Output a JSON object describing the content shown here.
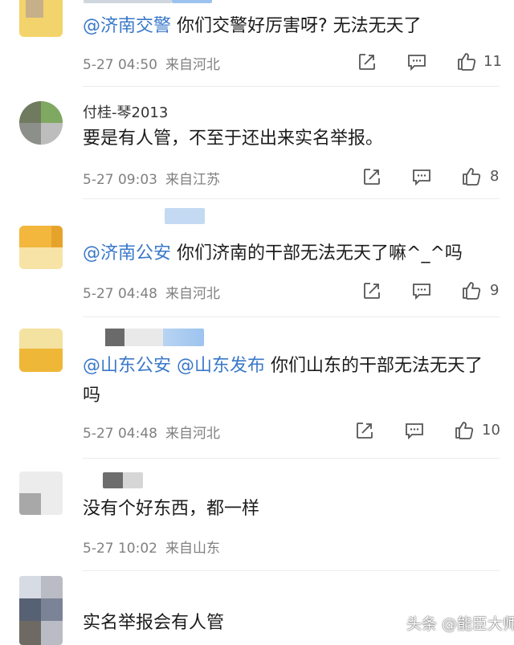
{
  "comments": [
    {
      "username": "",
      "mention": "@济南交警",
      "text": " 你们交警好厉害呀? 无法无天了",
      "time": "5-27 04:50",
      "location": "来自河北",
      "likes": "11"
    },
    {
      "username": "付桂-琴2013",
      "mention": "",
      "text": "要是有人管，不至于还出来实名举报。",
      "time": "5-27 09:03",
      "location": "来自江苏",
      "likes": "8"
    },
    {
      "username": "",
      "mention": "@济南公安",
      "text": " 你们济南的干部无法无天了嘛^_^吗",
      "time": "5-27 04:48",
      "location": "来自河北",
      "likes": "9"
    },
    {
      "username": "",
      "mention": "@山东公安",
      "mention2": "@山东发布",
      "text": " 你们山东的干部无法无天了吗",
      "time": "5-27 04:48",
      "location": "来自河北",
      "likes": "10"
    },
    {
      "username": "",
      "mention": "",
      "text": "没有个好东西，都一样",
      "time": "5-27 10:02",
      "location": "来自山东",
      "likes": ""
    },
    {
      "username": "",
      "mention": "",
      "text": "实名举报会有人管",
      "time": "",
      "location": "",
      "likes": ""
    }
  ],
  "watermark": "头条 @能臣大师",
  "colors": {
    "mention": "#3a78c9",
    "meta": "#808080",
    "text": "#1c1c1c"
  },
  "icons": [
    "share-icon",
    "comment-icon",
    "like-icon"
  ]
}
